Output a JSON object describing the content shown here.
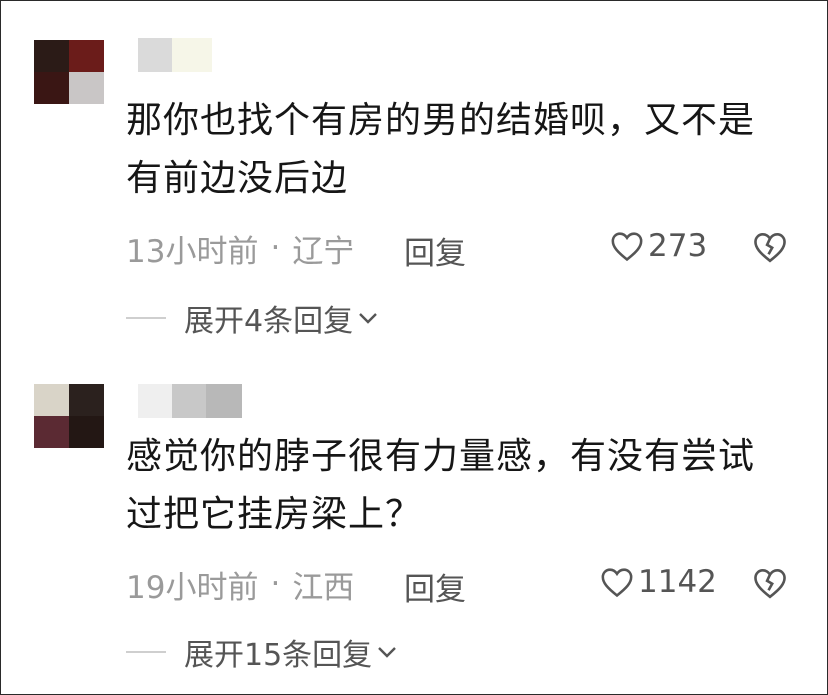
{
  "comments": [
    {
      "text": "那你也找个有房的男的结婚呗，又不是有前边没后边",
      "time": "13小时前",
      "separator": "·",
      "location": "辽宁",
      "reply_label": "回复",
      "likes": "273",
      "expand_label": "展开4条回复",
      "avatar_colors": [
        "#2b1b17",
        "#6b1c1a",
        "#3a1614",
        "#c9c6c6"
      ],
      "name_colors": [
        "#dadada",
        "#f6f6e8"
      ]
    },
    {
      "text": "感觉你的脖子很有力量感，有没有尝试过把它挂房梁上？",
      "time": "19小时前",
      "separator": "·",
      "location": "江西",
      "reply_label": "回复",
      "likes": "1142",
      "expand_label": "展开15条回复",
      "avatar_colors": [
        "#d9d4c8",
        "#2b211e",
        "#5b2a33",
        "#231714"
      ],
      "name_colors": [
        "#efefef",
        "#c8c8c8",
        "#b8b8b8"
      ]
    }
  ],
  "icons": {
    "heart": "heart-outline-icon",
    "dislike": "broken-heart-icon",
    "chevron": "chevron-down-icon"
  }
}
